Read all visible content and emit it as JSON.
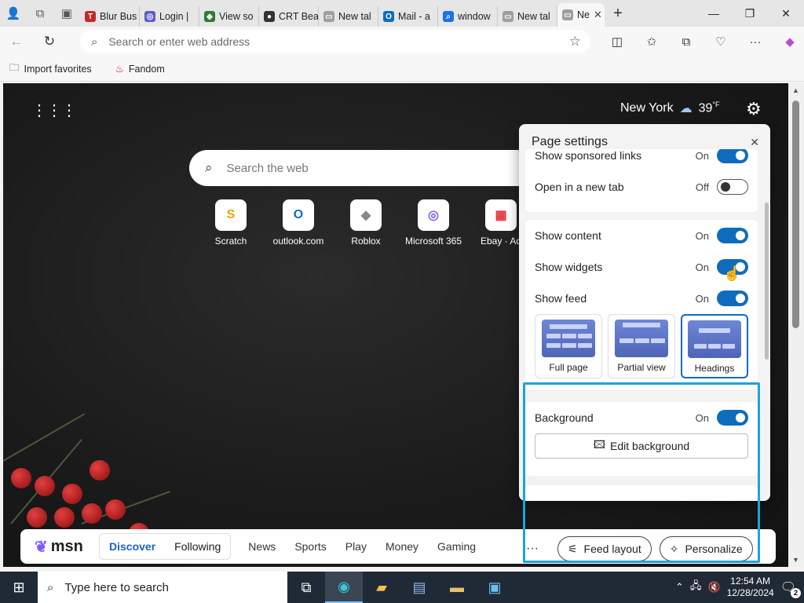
{
  "tabs": [
    {
      "label": "Blur Bus",
      "fav_color": "#c62828",
      "fav_glyph": "T"
    },
    {
      "label": "Login |",
      "fav_color": "#5b5fc7",
      "fav_glyph": "◎"
    },
    {
      "label": "View so",
      "fav_color": "#2e7d32",
      "fav_glyph": "◆"
    },
    {
      "label": "CRT Bea",
      "fav_color": "#333333",
      "fav_glyph": "●"
    },
    {
      "label": "New tal",
      "fav_color": "#9e9e9e",
      "fav_glyph": "▭"
    },
    {
      "label": "Mail - a",
      "fav_color": "#0f6cbd",
      "fav_glyph": "O"
    },
    {
      "label": "window",
      "fav_color": "#1a73e8",
      "fav_glyph": "⌕"
    },
    {
      "label": "New tal",
      "fav_color": "#9e9e9e",
      "fav_glyph": "▭"
    }
  ],
  "active_tab": {
    "label": "Ne",
    "close": "✕"
  },
  "new_tab": "+",
  "window_controls": {
    "minimize": "—",
    "maximize": "❐",
    "close": "✕"
  },
  "address": {
    "placeholder": "Search or enter web address"
  },
  "favorites": [
    {
      "label": "Import favorites",
      "icon": "folder-icon"
    },
    {
      "label": "Fandom",
      "icon": "flame-icon"
    }
  ],
  "newtab": {
    "weather": {
      "city": "New York",
      "temp": "39",
      "unit": "°F",
      "icon": "cloud-rain-icon"
    },
    "search_placeholder": "Search the web",
    "quick_links": [
      {
        "label": "Scratch",
        "glyph": "S",
        "color": "#f4a100"
      },
      {
        "label": "outlook.com",
        "glyph": "O",
        "color": "#0f6cbd"
      },
      {
        "label": "Roblox",
        "glyph": "◆",
        "color": "#888888"
      },
      {
        "label": "Microsoft 365",
        "glyph": "◎",
        "color": "#7d5cff"
      },
      {
        "label": "Ebay · Ad",
        "glyph": "▦",
        "color": "#e53238"
      }
    ]
  },
  "msn": {
    "logo": "msn",
    "discover": "Discover",
    "following": "Following",
    "nav": [
      "News",
      "Sports",
      "Play",
      "Money",
      "Gaming"
    ],
    "more": "···",
    "feed_layout": "Feed layout",
    "personalize": "Personalize"
  },
  "settings": {
    "title": "Page settings",
    "close": "✕",
    "sponsored_label": "Show sponsored links",
    "sponsored_state": "On",
    "newtab_label": "Open in a new tab",
    "newtab_state": "Off",
    "content_label": "Show content",
    "content_state": "On",
    "widgets_label": "Show widgets",
    "widgets_state": "On",
    "feed_label": "Show feed",
    "feed_state": "On",
    "layouts": [
      "Full page",
      "Partial view",
      "Headings"
    ],
    "selected_layout": "Headings",
    "background_label": "Background",
    "background_state": "On",
    "edit_background": "Edit background"
  },
  "taskbar": {
    "search_placeholder": "Type here to search",
    "time": "12:54 AM",
    "date": "12/28/2024",
    "notifications": "2"
  },
  "colors": {
    "accent": "#0f6cbd",
    "highlight": "#1fa3d8"
  }
}
